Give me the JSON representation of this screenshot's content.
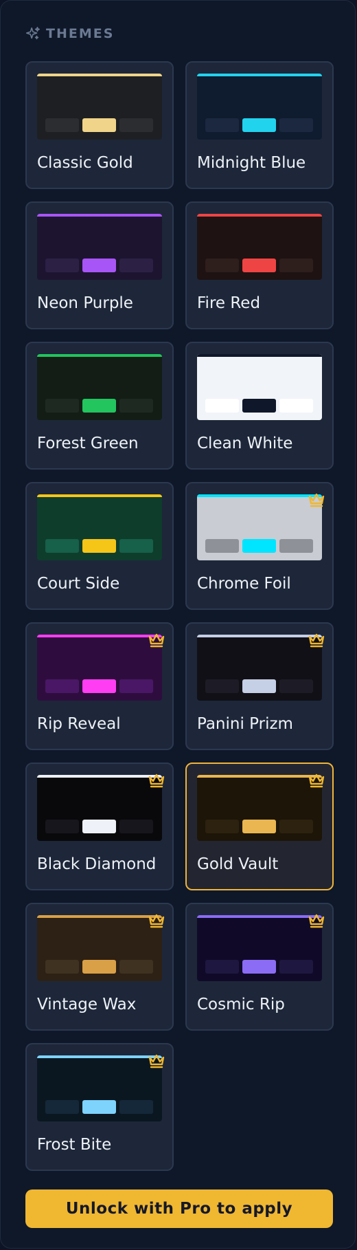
{
  "header": {
    "title": "THEMES",
    "icon": "sparkles-icon"
  },
  "themes": [
    {
      "name": "Classic Gold",
      "bg": "#1e1f22",
      "accent": "#f0d48a",
      "chip": "#2c2d30",
      "premium": false,
      "selected": false
    },
    {
      "name": "Midnight Blue",
      "bg": "#0f1b2e",
      "accent": "#22d3ee",
      "chip": "#1b2840",
      "premium": false,
      "selected": false
    },
    {
      "name": "Neon Purple",
      "bg": "#1d1430",
      "accent": "#a855f7",
      "chip": "#2c2045",
      "premium": false,
      "selected": false
    },
    {
      "name": "Fire Red",
      "bg": "#1e1212",
      "accent": "#ef4444",
      "chip": "#2e1e1c",
      "premium": false,
      "selected": false
    },
    {
      "name": "Forest Green",
      "bg": "#131d16",
      "accent": "#22c55e",
      "chip": "#1e2a21",
      "premium": false,
      "selected": false
    },
    {
      "name": "Clean White",
      "bg": "#f1f4f8",
      "accent": "#0f172a",
      "chip": "#ffffff",
      "topbar": "#0f172a",
      "premium": false,
      "selected": false
    },
    {
      "name": "Court Side",
      "bg": "#0e3d2c",
      "accent": "#f5c518",
      "chip": "#17604a",
      "premium": false,
      "selected": false
    },
    {
      "name": "Chrome Foil",
      "bg": "#c9ccd3",
      "accent": "#00e5ff",
      "chip": "#8e9198",
      "premium": true,
      "selected": false
    },
    {
      "name": "Rip Reveal",
      "bg": "#2e0d3e",
      "accent": "#ff3df2",
      "chip": "#4a1767",
      "premium": true,
      "selected": false
    },
    {
      "name": "Panini Prizm",
      "bg": "#111016",
      "accent": "#c5cfe6",
      "chip": "#1d1c26",
      "premium": true,
      "selected": false
    },
    {
      "name": "Black Diamond",
      "bg": "#09090b",
      "accent": "#eef1f7",
      "chip": "#17161c",
      "premium": true,
      "selected": false
    },
    {
      "name": "Gold Vault",
      "bg": "#1c1508",
      "accent": "#e9b651",
      "chip": "#2d220f",
      "premium": true,
      "selected": true
    },
    {
      "name": "Vintage Wax",
      "bg": "#2d2015",
      "accent": "#d9a047",
      "chip": "#3f3221",
      "premium": true,
      "selected": false
    },
    {
      "name": "Cosmic Rip",
      "bg": "#100a28",
      "accent": "#8b6cf4",
      "chip": "#1e1740",
      "premium": true,
      "selected": false
    },
    {
      "name": "Frost Bite",
      "bg": "#0b1720",
      "accent": "#7dd3fc",
      "chip": "#15283a",
      "premium": true,
      "selected": false
    }
  ],
  "unlock_button": {
    "label": "Unlock with Pro to apply",
    "bg": "#f0b731"
  },
  "crown_color": "#f0b731"
}
